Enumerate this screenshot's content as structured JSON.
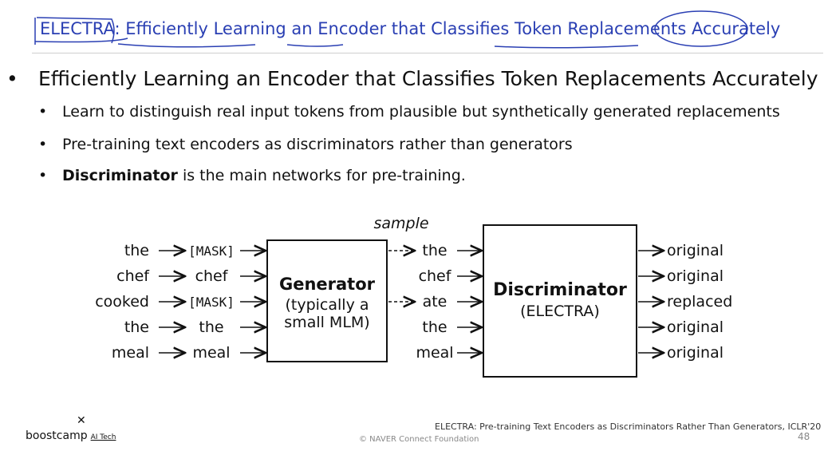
{
  "slide": {
    "title": "ELECTRA: Efficiently Learning an Encoder that Classifies Token Replacements Accurately",
    "bullet_main": "Efficiently Learning an Encoder that Classifies Token Replacements Accurately",
    "sub_bullets": [
      "Learn to distinguish real input tokens from plausible but synthetically generated replacements",
      "Pre-training text encoders as discriminators rather than generators"
    ],
    "sub_bullet_3_bold": "Discriminator",
    "sub_bullet_3_rest": " is the main networks for pre-training.",
    "bullet_glyph": "•"
  },
  "diagram": {
    "input_tokens": [
      "the",
      "chef",
      "cooked",
      "the",
      "meal"
    ],
    "masked_tokens": [
      "[MASK]",
      "chef",
      "[MASK]",
      "the",
      "meal"
    ],
    "generator_title": "Generator",
    "generator_sub1": "(typically a",
    "generator_sub2": "small MLM)",
    "sample_label": "sample",
    "sampled_tokens": [
      "the",
      "chef",
      "ate",
      "the",
      "meal"
    ],
    "discriminator_title": "Discriminator",
    "discriminator_sub": "(ELECTRA)",
    "outputs": [
      "original",
      "original",
      "replaced",
      "original",
      "original"
    ]
  },
  "footer": {
    "citation": "ELECTRA: Pre-training Text Encoders as Discriminators Rather Than Generators, ICLR'20",
    "copyright": "©  NAVER Connect Foundation",
    "page_number": "48",
    "logo_text": "boostcamp",
    "logo_sub": "AI Tech",
    "logo_mark": "✕"
  }
}
